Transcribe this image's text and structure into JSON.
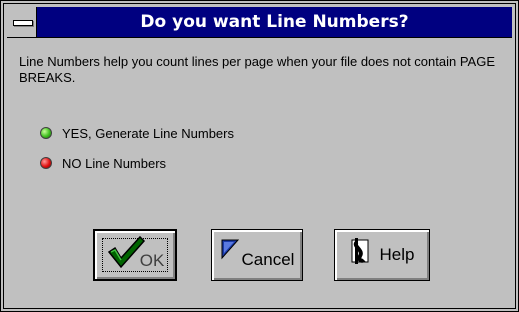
{
  "window": {
    "title": "Do you want Line Numbers?",
    "title_bar_color": "#000080",
    "face_color": "#c0c0c0"
  },
  "message": "Line Numbers help you count lines per page when your file does not contain PAGE BREAKS.",
  "options": [
    {
      "label": "YES, Generate Line Numbers",
      "indicator": "green",
      "color": "#3fbf1f"
    },
    {
      "label": "NO Line Numbers",
      "indicator": "red",
      "color": "#e01010"
    }
  ],
  "buttons": {
    "ok": {
      "label": "OK",
      "icon": "checkmark-icon"
    },
    "cancel": {
      "label": "Cancel",
      "icon": "cancel-icon"
    },
    "help": {
      "label": "Help",
      "icon": "help-icon"
    }
  }
}
